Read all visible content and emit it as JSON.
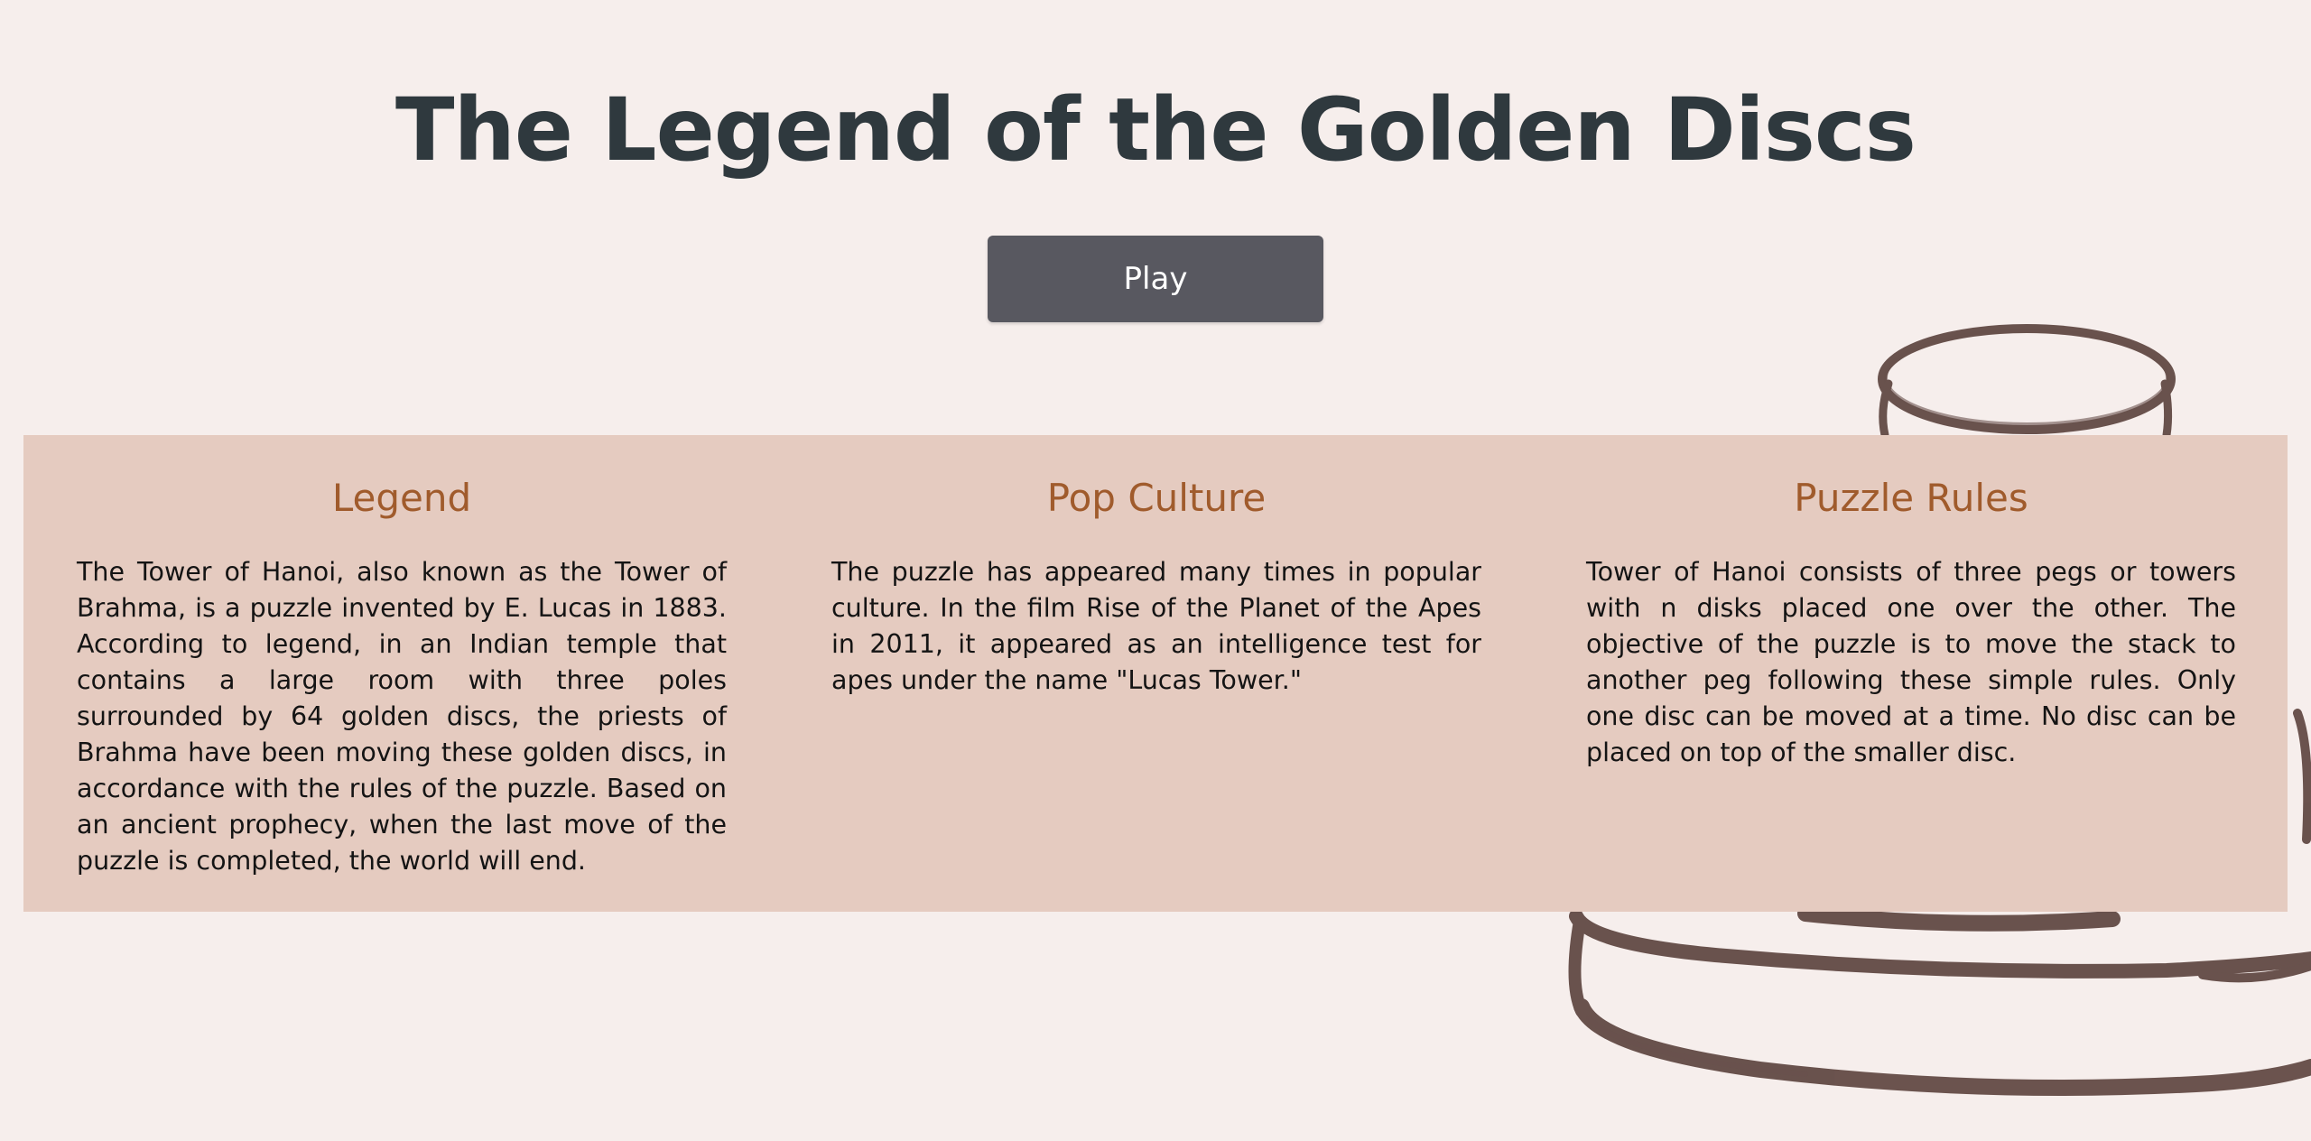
{
  "page": {
    "title": "The Legend of the Golden Discs",
    "play_label": "Play"
  },
  "sections": [
    {
      "heading": "Legend",
      "body": "The Tower of Hanoi, also known as the Tower of Brahma, is a puzzle invented by E. Lucas in 1883. According to legend, in an Indian temple that contains a large room with three poles surrounded by 64 golden discs, the priests of Brahma have been moving these golden discs, in accordance with the rules of the puzzle. Based on an ancient prophecy, when the last move of the puzzle is completed, the world will end."
    },
    {
      "heading": "Pop Culture",
      "body": "The puzzle has appeared many times in popular culture. In the film Rise of the Planet of the Apes in 2011, it appeared as an intelligence test for apes under the name \"Lucas Tower.\""
    },
    {
      "heading": "Puzzle Rules",
      "body": "Tower of Hanoi consists of three pegs or towers with n disks placed one over the other. The objective of the puzzle is to move the stack to another peg following these simple rules. Only one disc can be moved at a time. No disc can be placed on top of the smaller disc."
    }
  ],
  "colors": {
    "background": "#f6eeec",
    "panel": "#e5cbc0",
    "heading_accent": "#a05b2c",
    "button": "#585860",
    "brush_strokes": "#5e4540"
  },
  "decor": {
    "background_art": "brush-stroke-stacked-discs-illustration"
  }
}
